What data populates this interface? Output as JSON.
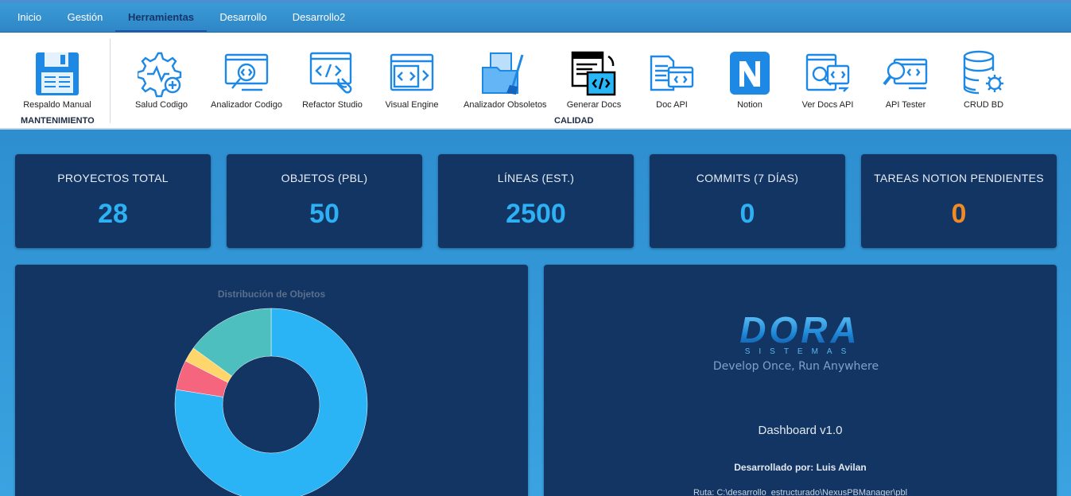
{
  "tabs": [
    {
      "label": "Inicio"
    },
    {
      "label": "Gestión"
    },
    {
      "label": "Herramientas",
      "active": true
    },
    {
      "label": "Desarrollo"
    },
    {
      "label": "Desarrollo2"
    }
  ],
  "ribbon": {
    "groups": {
      "maintenance": "MANTENIMIENTO",
      "quality": "CALIDAD"
    },
    "buttons": [
      {
        "label": "Respaldo Manual",
        "icon": "floppy-disk-icon"
      },
      {
        "label": "Salud Codigo",
        "icon": "gear-health-icon"
      },
      {
        "label": "Analizador Codigo",
        "icon": "code-analyzer-icon"
      },
      {
        "label": "Refactor Studio",
        "icon": "refactor-wrench-icon"
      },
      {
        "label": "Visual Engine",
        "icon": "code-windows-icon"
      },
      {
        "label": "Analizador Obsoletos",
        "icon": "folder-broom-icon"
      },
      {
        "label": "Generar Docs",
        "icon": "generate-docs-icon"
      },
      {
        "label": "Doc API",
        "icon": "doc-api-icon"
      },
      {
        "label": "Notion",
        "icon": "notion-icon"
      },
      {
        "label": "Ver Docs API",
        "icon": "view-docs-icon"
      },
      {
        "label": "API Tester",
        "icon": "api-tester-icon"
      },
      {
        "label": "CRUD BD",
        "icon": "database-gear-icon"
      }
    ]
  },
  "stats": [
    {
      "title": "PROYECTOS TOTAL",
      "value": "28"
    },
    {
      "title": "OBJETOS (PBL)",
      "value": "50"
    },
    {
      "title": "LÍNEAS (EST.)",
      "value": "2500"
    },
    {
      "title": "COMMITS (7 DÍAS)",
      "value": "0"
    },
    {
      "title": "TAREAS NOTION PENDIENTES",
      "value": "0",
      "color": "#f08a24"
    }
  ],
  "chart_data": {
    "type": "pie",
    "title": "Distribución de Objetos",
    "series": [
      {
        "values": [
          77.5,
          5.0,
          2.5,
          15.0
        ]
      }
    ],
    "colors": [
      "#2ab3f5",
      "#f5657e",
      "#fed66b",
      "#4dbfbf"
    ]
  },
  "about": {
    "logo_main": "DORA",
    "logo_sub": "SISTEMAS",
    "tagline": "Develop Once, Run Anywhere",
    "version": "Dashboard v1.0",
    "developer": "Desarrollado por: Luis Avilan",
    "path": "Ruta: C:\\desarrollo_estructurado\\NexusPBManager\\pbl"
  },
  "colors": {
    "card_bg": "#123563",
    "accent": "#2eb1f4",
    "warning": "#f08a24",
    "ribbon_bg": "#ffffff"
  }
}
